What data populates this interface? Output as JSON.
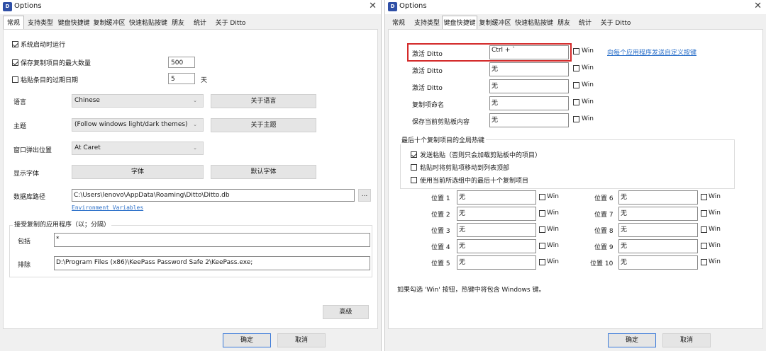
{
  "left": {
    "title": "Options",
    "tabs": [
      "常规",
      "支持类型",
      "键盘快捷键",
      "复制缓冲区",
      "快速粘贴按键",
      "朋友",
      "统计",
      "关于 Ditto"
    ],
    "start_on_boot": "系统启动时运行",
    "max_copies_label": "保存复制项目的最大数量",
    "max_copies_value": "500",
    "expire_label": "粘贴条目的过期日期",
    "expire_value": "5",
    "expire_unit": "天",
    "language_label": "语言",
    "language_value": "Chinese",
    "about_language": "关于语言",
    "theme_label": "主题",
    "theme_value": "(Follow windows light/dark themes)",
    "about_theme": "关于主题",
    "popup_label": "窗口弹出位置",
    "popup_value": "At Caret",
    "font_label": "显示字体",
    "font_button": "字体",
    "default_font_button": "默认字体",
    "db_label": "数据库路径",
    "db_value": "C:\\Users\\lenovo\\AppData\\Roaming\\Ditto\\Ditto.db",
    "browse": "...",
    "env_link": "Environment Variables",
    "accept_group": "接受复制的应用程序（以；分隔）",
    "include_label": "包括",
    "include_value": "*",
    "exclude_label": "排除",
    "exclude_value": "D:\\Program Files (x86)\\KeePass Password Safe 2\\KeePass.exe;",
    "advanced": "高级",
    "ok": "确定",
    "cancel": "取消"
  },
  "right": {
    "title": "Options",
    "tabs": [
      "常规",
      "支持类型",
      "键盘快捷键",
      "复制缓冲区",
      "快速粘贴按键",
      "朋友",
      "统计",
      "关于 Ditto"
    ],
    "hotkeys": [
      {
        "label": "激活 Ditto",
        "value": "Ctrl + `"
      },
      {
        "label": "激活 Ditto",
        "value": "无"
      },
      {
        "label": "激活 Ditto",
        "value": "无"
      },
      {
        "label": "复制项命名",
        "value": "无"
      },
      {
        "label": "保存当前剪贴板内容",
        "value": "无"
      }
    ],
    "win": "Win",
    "per_app_link": "向每个应用程序发送自定义按键",
    "last10_group": "最后十个复制项目的全局热键",
    "opt_send_paste": "发送粘贴（否则只会加载剪贴板中的项目）",
    "opt_move_top": "粘贴时将剪贴项移动到列表顶部",
    "opt_use_group": "使用当前所选组中的最后十个复制项目",
    "positions": [
      {
        "label": "位置 1",
        "value": "无"
      },
      {
        "label": "位置 2",
        "value": "无"
      },
      {
        "label": "位置 3",
        "value": "无"
      },
      {
        "label": "位置 4",
        "value": "无"
      },
      {
        "label": "位置 5",
        "value": "无"
      },
      {
        "label": "位置 6",
        "value": "无"
      },
      {
        "label": "位置 7",
        "value": "无"
      },
      {
        "label": "位置 8",
        "value": "无"
      },
      {
        "label": "位置 9",
        "value": "无"
      },
      {
        "label": "位置 10",
        "value": "无"
      }
    ],
    "footnote": "如果勾选 'Win' 按钮，热键中将包含 Windows 键。",
    "ok": "确定",
    "cancel": "取消"
  }
}
